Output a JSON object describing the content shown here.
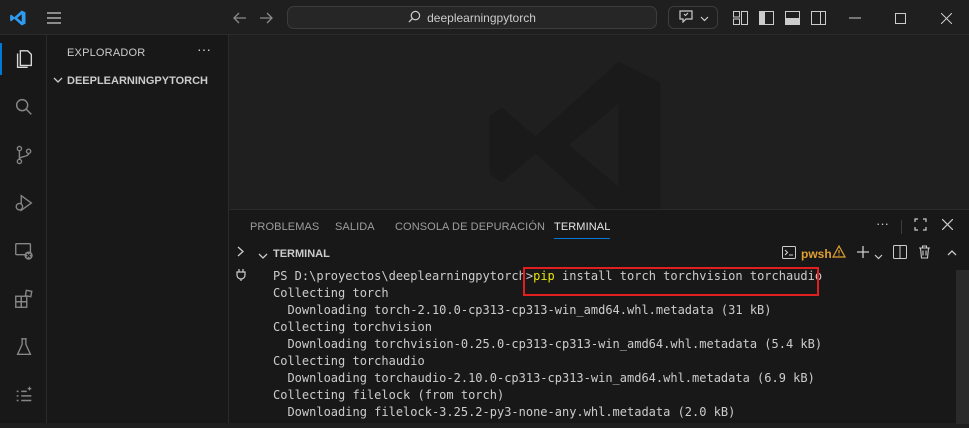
{
  "titlebar": {
    "search_text": "deeplearningpytorch"
  },
  "sidebar": {
    "title": "EXPLORADOR",
    "more": "···",
    "folder_name": "DEEPLEARNINGPYTORCH"
  },
  "panel": {
    "tabs": [
      "PROBLEMAS",
      "SALIDA",
      "CONSOLA DE DEPURACIÓN",
      "TERMINAL"
    ],
    "active_tab": "TERMINAL",
    "section_title": "TERMINAL",
    "shell_name": "pwsh"
  },
  "terminal": {
    "prompt": "PS D:\\proyectos\\deeplearningpytorch>",
    "command_word": "pip",
    "command_rest": " install torch torchvision torchaudio",
    "lines": [
      "Collecting torch",
      "  Downloading torch-2.10.0-cp313-cp313-win_amd64.whl.metadata (31 kB)",
      "Collecting torchvision",
      "  Downloading torchvision-0.25.0-cp313-cp313-win_amd64.whl.metadata (5.4 kB)",
      "Collecting torchaudio",
      "  Downloading torchaudio-2.10.0-cp313-cp313-win_amd64.whl.metadata (6.9 kB)",
      "Collecting filelock (from torch)",
      "  Downloading filelock-3.25.2-py3-none-any.whl.metadata (2.0 kB)"
    ]
  },
  "colors": {
    "accent": "#0078d4",
    "highlight_box": "#e02020",
    "command_yellow": "#e5e510"
  },
  "icons": [
    "vscode-logo-icon",
    "menu-icon",
    "back-arrow-icon",
    "forward-arrow-icon",
    "search-icon",
    "copilot-icon",
    "chevron-down-icon",
    "layout-icon",
    "toggle-sidebar-icon",
    "toggle-panel-icon",
    "toggle-secondary-sidebar-icon",
    "minimize-icon",
    "maximize-icon",
    "close-icon",
    "explorer-icon",
    "search-view-icon",
    "source-control-icon",
    "run-debug-icon",
    "remote-explorer-icon",
    "extensions-icon",
    "testing-icon",
    "more-tools-icon",
    "terminal-shell-icon",
    "warning-icon",
    "add-terminal-icon",
    "split-terminal-icon",
    "trash-icon",
    "maximize-panel-icon",
    "close-panel-icon"
  ]
}
